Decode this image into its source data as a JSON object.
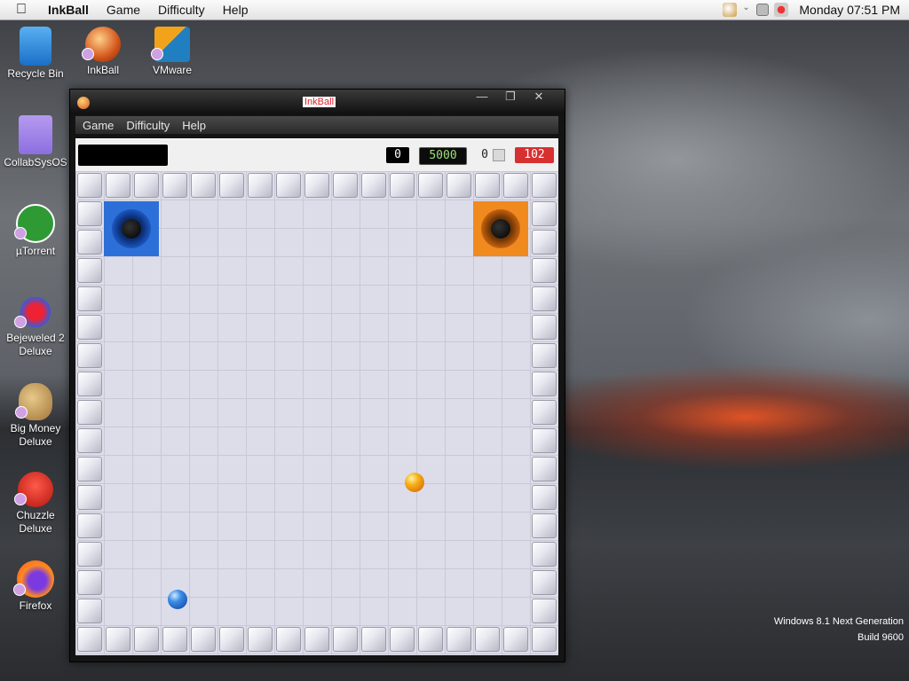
{
  "menubar": {
    "apple": "",
    "app_name": "InkBall",
    "items": [
      "Game",
      "Difficulty",
      "Help"
    ],
    "clock": "Monday 07:51 PM"
  },
  "desktop_icons": [
    {
      "label": "Recycle Bin",
      "icon": "recycle-bin-icon"
    },
    {
      "label": "InkBall",
      "icon": "inkball-icon"
    },
    {
      "label": "VMware",
      "icon": "vmware-icon"
    },
    {
      "label": "CollabSysOS",
      "icon": "folder-icon"
    },
    {
      "label": "µTorrent",
      "icon": "utorrent-icon"
    },
    {
      "label": "Bejeweled 2\nDeluxe",
      "icon": "bejeweled-icon"
    },
    {
      "label": "Big Money\nDeluxe",
      "icon": "money-bag-icon"
    },
    {
      "label": "Chuzzle\nDeluxe",
      "icon": "chuzzle-icon"
    },
    {
      "label": "Firefox",
      "icon": "firefox-icon"
    }
  ],
  "watermark": {
    "line1": "Windows 8.1 Next Generation",
    "line2": "Build 9600"
  },
  "window": {
    "title": "InkBall",
    "controls": {
      "minimize": "—",
      "maximize": "❐",
      "close": "✕"
    },
    "menu": [
      "Game",
      "Difficulty",
      "Help"
    ],
    "score": "0",
    "goal": "5000",
    "balls_remaining": "0",
    "timer": "102"
  },
  "board": {
    "holes": [
      {
        "color": "blue"
      },
      {
        "color": "orange"
      }
    ],
    "balls": [
      {
        "color": "orange"
      },
      {
        "color": "blue"
      }
    ]
  },
  "colors": {
    "timer_bg": "#d73030",
    "goal_text": "#9ee07a",
    "title_text": "#e0202a"
  }
}
